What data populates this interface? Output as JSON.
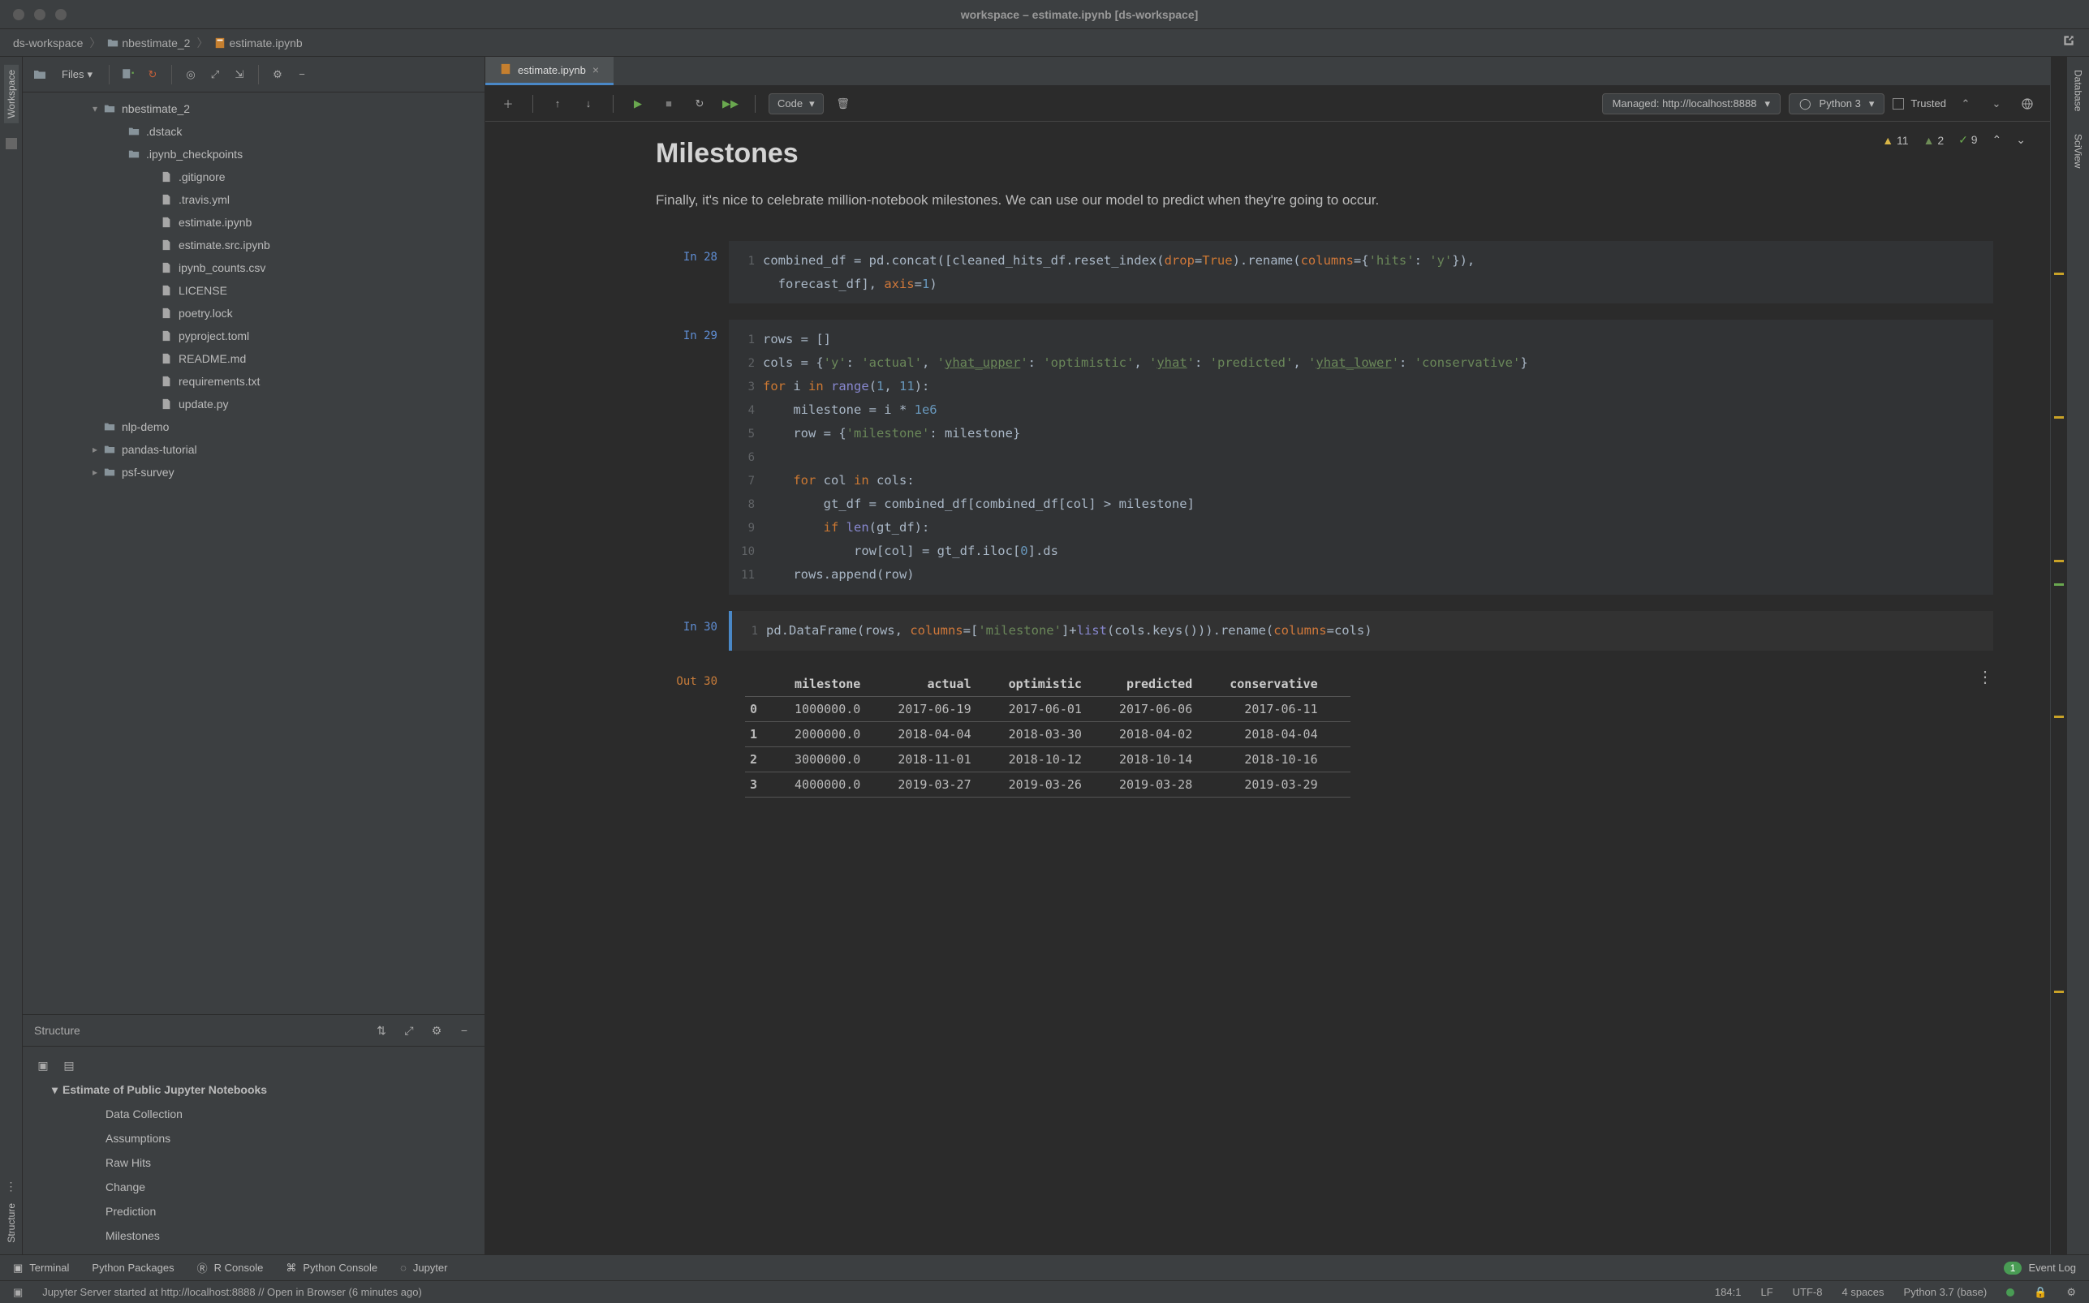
{
  "window": {
    "title": "workspace – estimate.ipynb [ds-workspace]"
  },
  "breadcrumbs": {
    "project": "ds-workspace",
    "folder": "nbestimate_2",
    "file": "estimate.ipynb"
  },
  "left_rail": {
    "workspace": "Workspace",
    "structure": "Structure"
  },
  "right_rail": {
    "database": "Database",
    "sciview": "SciView"
  },
  "files": {
    "label": "Files",
    "tree": [
      {
        "name": "nbestimate_2",
        "type": "folder",
        "depth": 1,
        "open": true
      },
      {
        "name": ".dstack",
        "type": "folder",
        "depth": 2
      },
      {
        "name": ".ipynb_checkpoints",
        "type": "folder",
        "depth": 2
      },
      {
        "name": ".gitignore",
        "type": "file",
        "depth": 3
      },
      {
        "name": ".travis.yml",
        "type": "file",
        "depth": 3
      },
      {
        "name": "estimate.ipynb",
        "type": "file",
        "depth": 3
      },
      {
        "name": "estimate.src.ipynb",
        "type": "file",
        "depth": 3
      },
      {
        "name": "ipynb_counts.csv",
        "type": "file",
        "depth": 3
      },
      {
        "name": "LICENSE",
        "type": "file",
        "depth": 3
      },
      {
        "name": "poetry.lock",
        "type": "file",
        "depth": 3
      },
      {
        "name": "pyproject.toml",
        "type": "file",
        "depth": 3
      },
      {
        "name": "README.md",
        "type": "file",
        "depth": 3
      },
      {
        "name": "requirements.txt",
        "type": "file",
        "depth": 3
      },
      {
        "name": "update.py",
        "type": "file",
        "depth": 3
      },
      {
        "name": "nlp-demo",
        "type": "folder",
        "depth": 1
      },
      {
        "name": "pandas-tutorial",
        "type": "folder",
        "depth": 1,
        "chev": true
      },
      {
        "name": "psf-survey",
        "type": "folder",
        "depth": 1,
        "chev": true
      }
    ]
  },
  "structure": {
    "label": "Structure",
    "root": "Estimate of Public Jupyter Notebooks",
    "items": [
      "Data Collection",
      "Assumptions",
      "Raw Hits",
      "Change",
      "Prediction",
      "Milestones"
    ]
  },
  "tab": {
    "label": "estimate.ipynb"
  },
  "nb_toolbar": {
    "cell_type": "Code",
    "managed": "Managed: http://localhost:8888",
    "kernel": "Python 3",
    "trusted": "Trusted"
  },
  "counters": {
    "warn1": "11",
    "warn2": "2",
    "ok": "9"
  },
  "markdown": {
    "title": "Milestones",
    "para": "Finally, it's nice to celebrate million-notebook milestones. We can use our model to predict when they're going to occur."
  },
  "cells": {
    "in28": {
      "label": "In 28",
      "lines": [
        {
          "n": "1",
          "html": "combined_df = pd.concat([cleaned_hits_df.reset_index(<span class='param'>drop</span>=<span class='kw'>True</span>).rename(<span class='param'>columns</span>={<span class='str'>'hits'</span>: <span class='str'>'y'</span>}),"
        },
        {
          "n": "",
          "html": "  forecast_df], <span class='param'>axis</span>=<span class='num'>1</span>)"
        }
      ]
    },
    "in29": {
      "label": "In 29",
      "lines": [
        {
          "n": "1",
          "html": "rows = []"
        },
        {
          "n": "2",
          "html": "cols = {<span class='str'>'y'</span>: <span class='str'>'actual'</span>, <span class='str'>'<span class='underl'>yhat_upper</span>'</span>: <span class='str'>'optimistic'</span>, <span class='str'>'<span class='underl'>yhat</span>'</span>: <span class='str'>'predicted'</span>, <span class='str'>'<span class='underl'>yhat_lower</span>'</span>: <span class='str'>'conservative'</span>}"
        },
        {
          "n": "3",
          "html": "<span class='kw'>for</span> i <span class='kw'>in</span> <span class='bi'>range</span>(<span class='num'>1</span>, <span class='num'>11</span>):"
        },
        {
          "n": "4",
          "html": "    milestone = i * <span class='num'>1e6</span>"
        },
        {
          "n": "5",
          "html": "    row = {<span class='str'>'milestone'</span>: milestone}"
        },
        {
          "n": "6",
          "html": ""
        },
        {
          "n": "7",
          "html": "    <span class='kw'>for</span> col <span class='kw'>in</span> cols:"
        },
        {
          "n": "8",
          "html": "        gt_df = combined_df[combined_df[col] &gt; milestone]"
        },
        {
          "n": "9",
          "html": "        <span class='kw'>if</span> <span class='bi'>len</span>(gt_df):"
        },
        {
          "n": "10",
          "html": "            row[col] = gt_df.iloc[<span class='num'>0</span>].ds"
        },
        {
          "n": "11",
          "html": "    rows.append(row)"
        }
      ]
    },
    "in30": {
      "label": "In 30",
      "lines": [
        {
          "n": "1",
          "html": "pd.DataFrame(rows, <span class='param'>columns</span>=[<span class='str'>'milestone'</span>]+<span class='bi'>list</span>(cols.keys())).rename(<span class='param'>columns</span>=cols)"
        }
      ]
    },
    "out30": {
      "label": "Out 30",
      "columns": [
        "",
        "milestone",
        "actual",
        "optimistic",
        "predicted",
        "conservative"
      ],
      "rows": [
        [
          "0",
          "1000000.0",
          "2017-06-19",
          "2017-06-01",
          "2017-06-06",
          "2017-06-11"
        ],
        [
          "1",
          "2000000.0",
          "2018-04-04",
          "2018-03-30",
          "2018-04-02",
          "2018-04-04"
        ],
        [
          "2",
          "3000000.0",
          "2018-11-01",
          "2018-10-12",
          "2018-10-14",
          "2018-10-16"
        ],
        [
          "3",
          "4000000.0",
          "2019-03-27",
          "2019-03-26",
          "2019-03-28",
          "2019-03-29"
        ]
      ]
    }
  },
  "bottom_tools": {
    "terminal": "Terminal",
    "python_packages": "Python Packages",
    "r_console": "R Console",
    "python_console": "Python Console",
    "jupyter": "Jupyter",
    "event_log_count": "1",
    "event_log": "Event Log"
  },
  "status": {
    "message": "Jupyter Server started at http://localhost:8888 // Open in Browser (6 minutes ago)",
    "pos": "184:1",
    "lf": "LF",
    "enc": "UTF-8",
    "indent": "4 spaces",
    "interp": "Python 3.7 (base)"
  }
}
